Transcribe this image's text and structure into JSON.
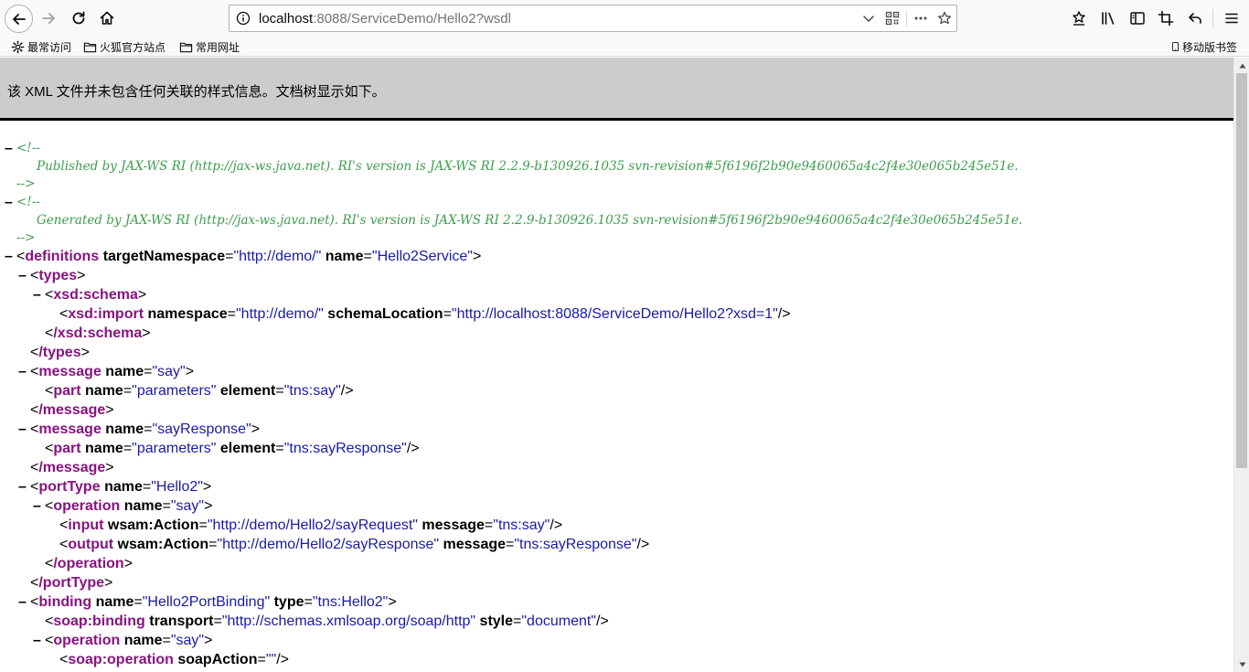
{
  "browser": {
    "url_host": "localhost",
    "url_rest": ":8088/ServiceDemo/Hello2?wsdl"
  },
  "bookmarks": [
    {
      "label": "最常访问",
      "icon": "gear-icon"
    },
    {
      "label": "火狐官方站点",
      "icon": "folder-icon"
    },
    {
      "label": "常用网址",
      "icon": "folder-icon"
    },
    {
      "label": "移动版书签",
      "icon": "mobile-icon"
    }
  ],
  "info_message": "该 XML 文件并未包含任何关联的样式信息。文档树显示如下。",
  "xml": {
    "comment_open": "<!--",
    "comment_close": "-->",
    "comment1": "Published by JAX-WS RI (http://jax-ws.java.net). RI's version is JAX-WS RI 2.2.9-b130926.1035 svn-revision#5f6196f2b90e9460065a4c2f4e30e065b245e51e.",
    "comment2": "Generated by JAX-WS RI (http://jax-ws.java.net). RI's version is JAX-WS RI 2.2.9-b130926.1035 svn-revision#5f6196f2b90e9460065a4c2f4e30e065b245e51e.",
    "definitions": {
      "tag": "definitions",
      "a1": "targetNamespace",
      "v1": "\"http://demo/\"",
      "a2": "name",
      "v2": "\"Hello2Service\""
    },
    "types": {
      "tag": "types",
      "close": "/types"
    },
    "schema": {
      "tag": "xsd:schema",
      "close": "/xsd:schema"
    },
    "import": {
      "tag": "xsd:import",
      "a1": "namespace",
      "v1": "\"http://demo/\"",
      "a2": "schemaLocation",
      "v2": "\"http://localhost:8088/ServiceDemo/Hello2?xsd=1\""
    },
    "message1": {
      "tag": "message",
      "a1": "name",
      "v1": "\"say\"",
      "close": "/message"
    },
    "part1": {
      "tag": "part",
      "a1": "name",
      "v1": "\"parameters\"",
      "a2": "element",
      "v2": "\"tns:say\""
    },
    "message2": {
      "tag": "message",
      "a1": "name",
      "v1": "\"sayResponse\"",
      "close": "/message"
    },
    "part2": {
      "tag": "part",
      "a1": "name",
      "v1": "\"parameters\"",
      "a2": "element",
      "v2": "\"tns:sayResponse\""
    },
    "porttype": {
      "tag": "portType",
      "a1": "name",
      "v1": "\"Hello2\"",
      "close": "/portType"
    },
    "operation1": {
      "tag": "operation",
      "a1": "name",
      "v1": "\"say\"",
      "close": "/operation"
    },
    "input": {
      "tag": "input",
      "a1": "wsam:Action",
      "v1": "\"http://demo/Hello2/sayRequest\"",
      "a2": "message",
      "v2": "\"tns:say\""
    },
    "output": {
      "tag": "output",
      "a1": "wsam:Action",
      "v1": "\"http://demo/Hello2/sayResponse\"",
      "a2": "message",
      "v2": "\"tns:sayResponse\""
    },
    "binding": {
      "tag": "binding",
      "a1": "name",
      "v1": "\"Hello2PortBinding\"",
      "a2": "type",
      "v2": "\"tns:Hello2\""
    },
    "soapbinding": {
      "tag": "soap:binding",
      "a1": "transport",
      "v1": "\"http://schemas.xmlsoap.org/soap/http\"",
      "a2": "style",
      "v2": "\"document\""
    },
    "operation2": {
      "tag": "operation",
      "a1": "name",
      "v1": "\"say\""
    },
    "soapoperation": {
      "tag": "soap:operation",
      "a1": "soapAction",
      "v1": "\"\""
    }
  }
}
